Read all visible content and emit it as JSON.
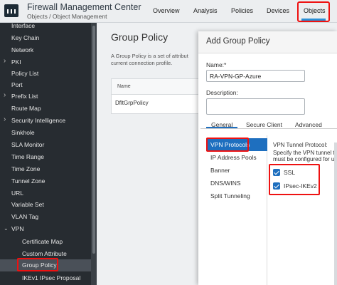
{
  "header": {
    "app_title": "Firewall Management Center",
    "breadcrumb": "Objects / Object Management",
    "tabs": [
      "Overview",
      "Analysis",
      "Policies",
      "Devices",
      "Objects"
    ],
    "active_tab": "Objects",
    "accent_color": "#2a8fd6",
    "highlight_color": "#e11111"
  },
  "sidebar": {
    "items": [
      {
        "label": "Interface",
        "chevron": false
      },
      {
        "label": "Key Chain",
        "chevron": false
      },
      {
        "label": "Network",
        "chevron": false
      },
      {
        "label": "PKI",
        "chevron": true
      },
      {
        "label": "Policy List",
        "chevron": false
      },
      {
        "label": "Port",
        "chevron": false
      },
      {
        "label": "Prefix List",
        "chevron": true
      },
      {
        "label": "Route Map",
        "chevron": false
      },
      {
        "label": "Security Intelligence",
        "chevron": true
      },
      {
        "label": "Sinkhole",
        "chevron": false
      },
      {
        "label": "SLA Monitor",
        "chevron": false
      },
      {
        "label": "Time Range",
        "chevron": false
      },
      {
        "label": "Time Zone",
        "chevron": false
      },
      {
        "label": "Tunnel Zone",
        "chevron": false
      },
      {
        "label": "URL",
        "chevron": false
      },
      {
        "label": "Variable Set",
        "chevron": false
      },
      {
        "label": "VLAN Tag",
        "chevron": false
      },
      {
        "label": "VPN",
        "chevron": true,
        "expanded": true
      },
      {
        "label": "Certificate Map",
        "chevron": false,
        "sub": true
      },
      {
        "label": "Custom Attribute",
        "chevron": false,
        "sub": true
      },
      {
        "label": "Group Policy",
        "chevron": false,
        "sub": true,
        "selected": true
      },
      {
        "label": "IKEv1 IPsec Proposal",
        "chevron": false,
        "sub": true
      }
    ]
  },
  "main": {
    "title": "Group Policy",
    "description_line1": "A Group Policy is a set of attribut",
    "description_line2": "current connection profile.",
    "table": {
      "header": "Name",
      "rows": [
        "DfltGrpPolicy"
      ]
    }
  },
  "dialog": {
    "title": "Add Group Policy",
    "name_label": "Name:*",
    "name_value": "RA-VPN-GP-Azure",
    "description_label": "Description:",
    "description_value": "",
    "tabs": [
      "General",
      "Secure Client",
      "Advanced"
    ],
    "active_tab": "General",
    "left_menu": [
      "VPN Protocols",
      "IP Address Pools",
      "Banner",
      "DNS/WINS",
      "Split Tunneling"
    ],
    "left_menu_selected": "VPN Protocols",
    "right": {
      "heading": "VPN Tunnel Protocol:",
      "line1": "Specify the VPN tunnel t",
      "line2": "must be configured for us",
      "options": [
        {
          "label": "SSL",
          "checked": true
        },
        {
          "label": "IPsec-IKEv2",
          "checked": true
        }
      ]
    }
  }
}
